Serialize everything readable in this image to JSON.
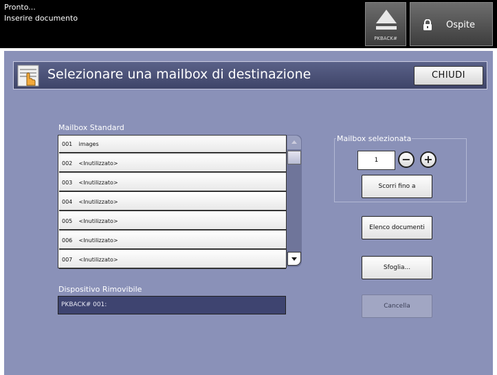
{
  "status": {
    "line1": "Pronto...",
    "line2": "Inserire documento"
  },
  "eject": {
    "label": "PKBACK#",
    "icon": "eject-icon"
  },
  "user": {
    "label": "Ospite",
    "icon": "lock-icon"
  },
  "title": {
    "text": "Selezionare una mailbox di destinazione",
    "icon": "hand-pointer-icon",
    "close_label": "CHIUDI"
  },
  "mailbox_list": {
    "label": "Mailbox Standard",
    "rows": [
      {
        "num": "001",
        "name": "images"
      },
      {
        "num": "002",
        "name": "<Inutilizzato>"
      },
      {
        "num": "003",
        "name": "<Inutilizzato>"
      },
      {
        "num": "004",
        "name": "<Inutilizzato>"
      },
      {
        "num": "005",
        "name": "<Inutilizzato>"
      },
      {
        "num": "006",
        "name": "<Inutilizzato>"
      },
      {
        "num": "007",
        "name": "<Inutilizzato>"
      }
    ]
  },
  "removable": {
    "label": "Dispositivo Rimovibile",
    "value": "PKBACK# 001:"
  },
  "selected": {
    "label": "Mailbox selezionata",
    "value": "1",
    "minus": "−",
    "plus": "+"
  },
  "buttons": {
    "scroll_to": "Scorri fino a",
    "doc_list": "Elenco documenti",
    "browse": "Sfoglia...",
    "delete": "Cancella"
  },
  "colors": {
    "panel": "#8a91b8",
    "titlebar": "#4a5178",
    "field_dark": "#3e4470"
  }
}
